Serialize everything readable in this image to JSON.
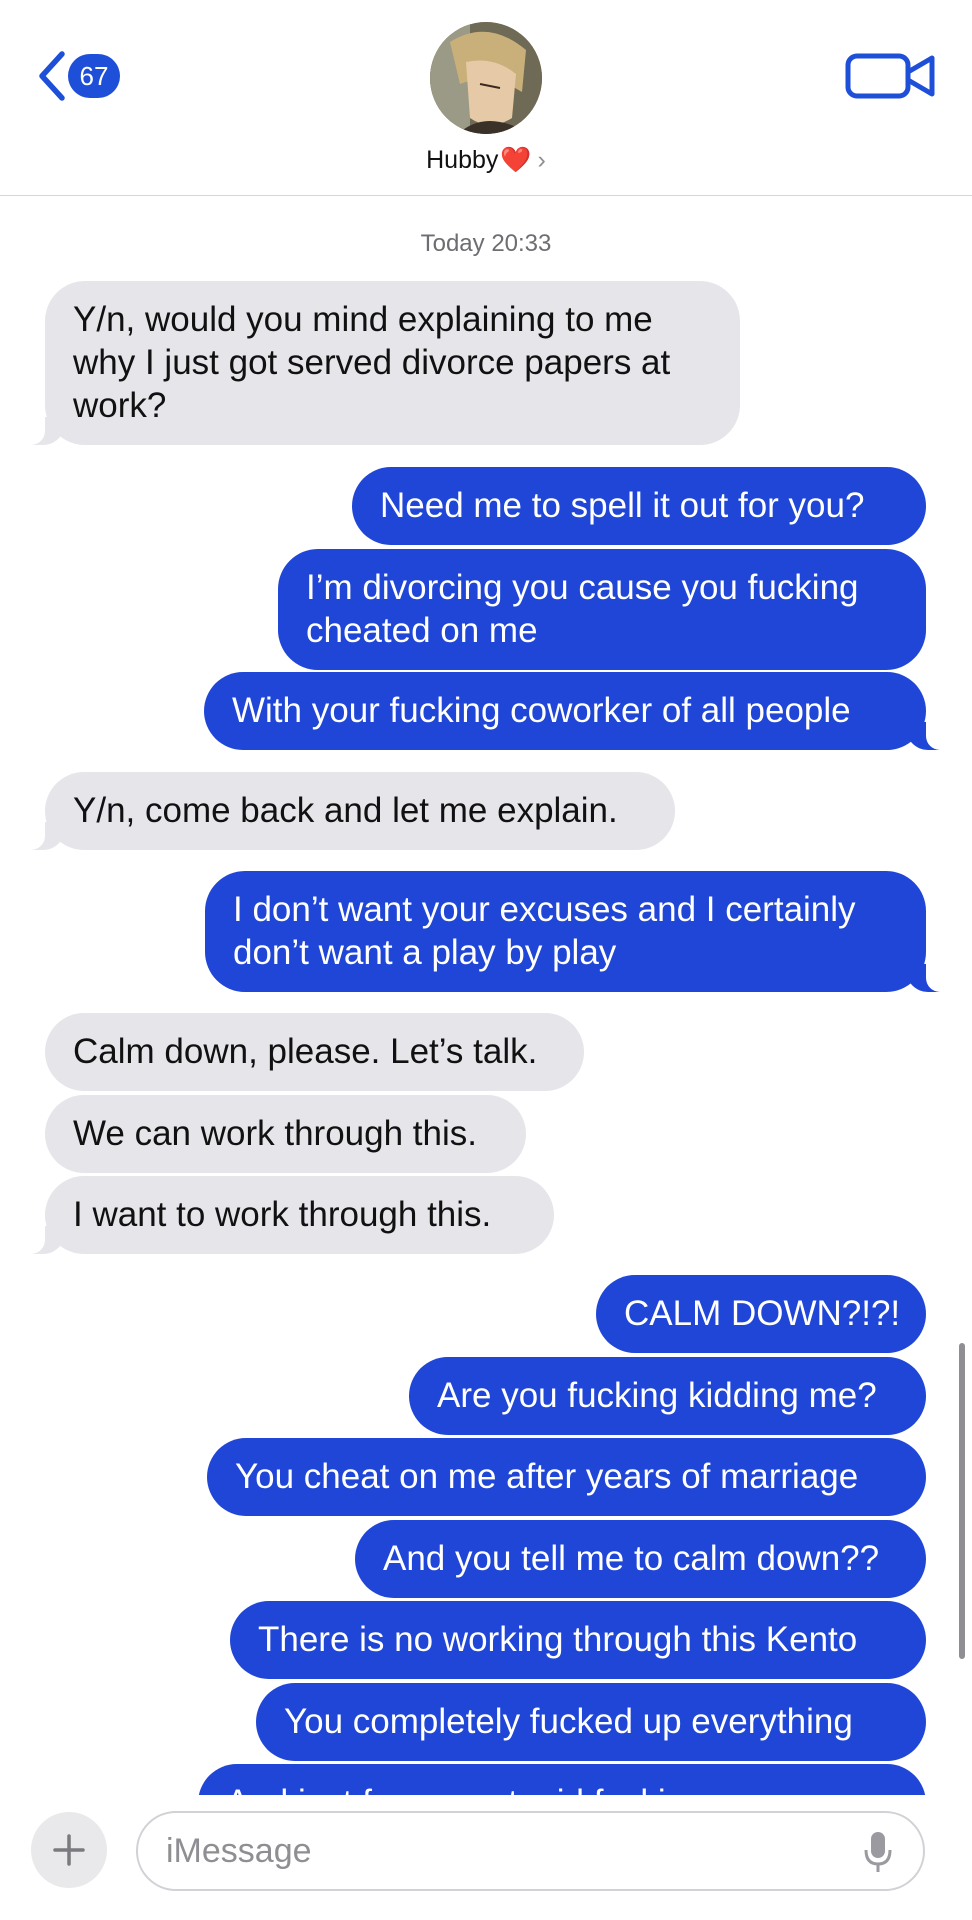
{
  "header": {
    "back_count": "67",
    "contact_name": "Hubby",
    "contact_emoji": "❤️",
    "chevron": "›",
    "icons": [
      "back-chevron-icon",
      "video-camera-icon"
    ]
  },
  "thread": {
    "timestamp": "Today 20:33",
    "messages": [
      {
        "from": "them",
        "text": [
          "Y/n, would you mind explaining to me",
          "why I just got served divorce papers at",
          "work?"
        ]
      },
      {
        "from": "me",
        "text": [
          "Need me to spell it out for you?"
        ]
      },
      {
        "from": "me",
        "text": [
          "I’m divorcing you cause you fucking",
          "cheated on me"
        ]
      },
      {
        "from": "me",
        "text": [
          "With your fucking coworker of all people"
        ]
      },
      {
        "from": "them",
        "text": [
          "Y/n, come back and let me explain."
        ]
      },
      {
        "from": "me",
        "text": [
          "I don’t want your excuses and I certainly",
          "don’t want a play by play"
        ]
      },
      {
        "from": "them",
        "text": [
          "Calm down, please. Let’s talk."
        ]
      },
      {
        "from": "them",
        "text": [
          "We can work through this."
        ]
      },
      {
        "from": "them",
        "text": [
          "I want to work through this."
        ]
      },
      {
        "from": "me",
        "text": [
          "CALM DOWN?!?!"
        ]
      },
      {
        "from": "me",
        "text": [
          "Are you fucking kidding me?"
        ]
      },
      {
        "from": "me",
        "text": [
          "You cheat on me after years of marriage"
        ]
      },
      {
        "from": "me",
        "text": [
          "And you tell me to calm down??"
        ]
      },
      {
        "from": "me",
        "text": [
          "There is no working through this Kento"
        ]
      },
      {
        "from": "me",
        "text": [
          "You completely fucked up everything"
        ]
      },
      {
        "from": "me",
        "text": [
          "And just for your stupid fucking message"
        ]
      }
    ]
  },
  "composer": {
    "placeholder": "iMessage",
    "icons": [
      "plus-icon",
      "microphone-icon"
    ]
  },
  "colors": {
    "outgoing_bubble": "#1f46d6",
    "incoming_bubble": "#e5e5ea",
    "accent": "#1d4fd8"
  }
}
